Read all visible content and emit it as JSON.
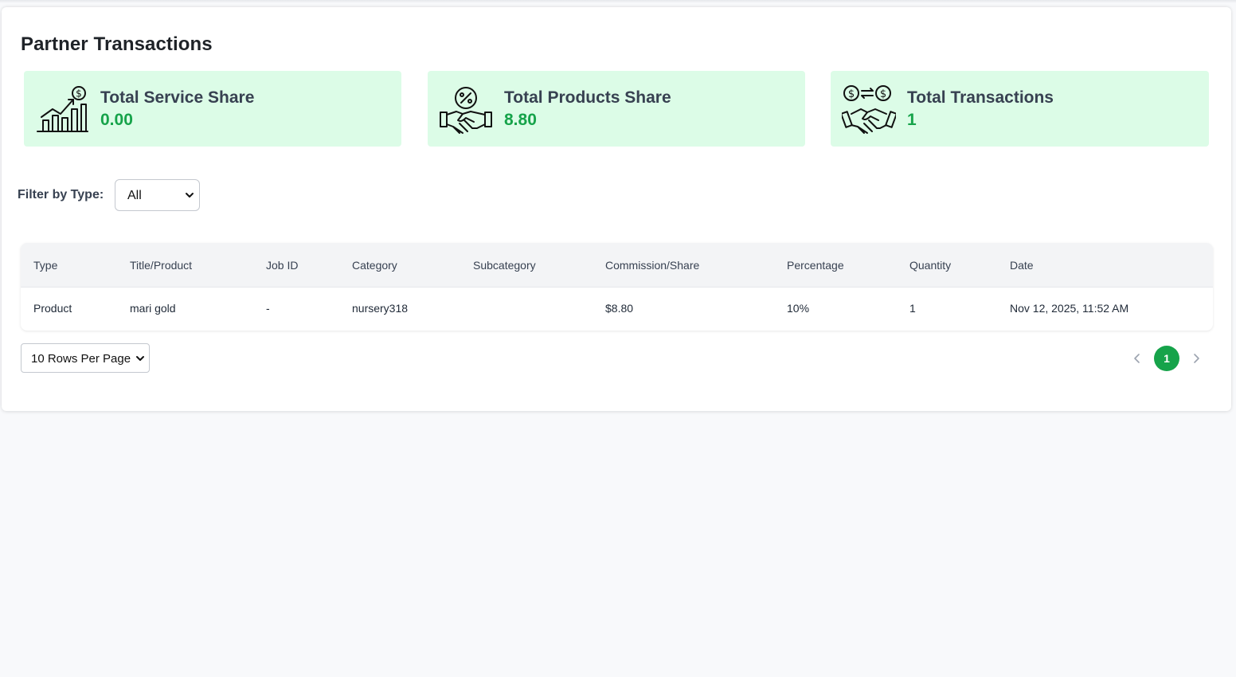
{
  "page": {
    "title": "Partner Transactions"
  },
  "stats": [
    {
      "label": "Total Service Share",
      "value": "0.00",
      "icon": "growth-chart-dollar-icon"
    },
    {
      "label": "Total Products Share",
      "value": "8.80",
      "icon": "handshake-percent-icon"
    },
    {
      "label": "Total Transactions",
      "value": "1",
      "icon": "handshake-exchange-icon"
    }
  ],
  "filter": {
    "label": "Filter by Type:",
    "selected": "All"
  },
  "table": {
    "columns": [
      "Type",
      "Title/Product",
      "Job ID",
      "Category",
      "Subcategory",
      "Commission/Share",
      "Percentage",
      "Quantity",
      "Date"
    ],
    "rows": [
      [
        "Product",
        "mari gold",
        "-",
        "nursery318",
        "",
        "$8.80",
        "10%",
        "1",
        "Nov 12, 2025, 11:52 AM"
      ]
    ]
  },
  "pagination": {
    "rows_per_page": "10 Rows Per Page",
    "current_page": "1"
  },
  "colors": {
    "accent": "#16a34a",
    "card_bg": "#dcfce7"
  }
}
